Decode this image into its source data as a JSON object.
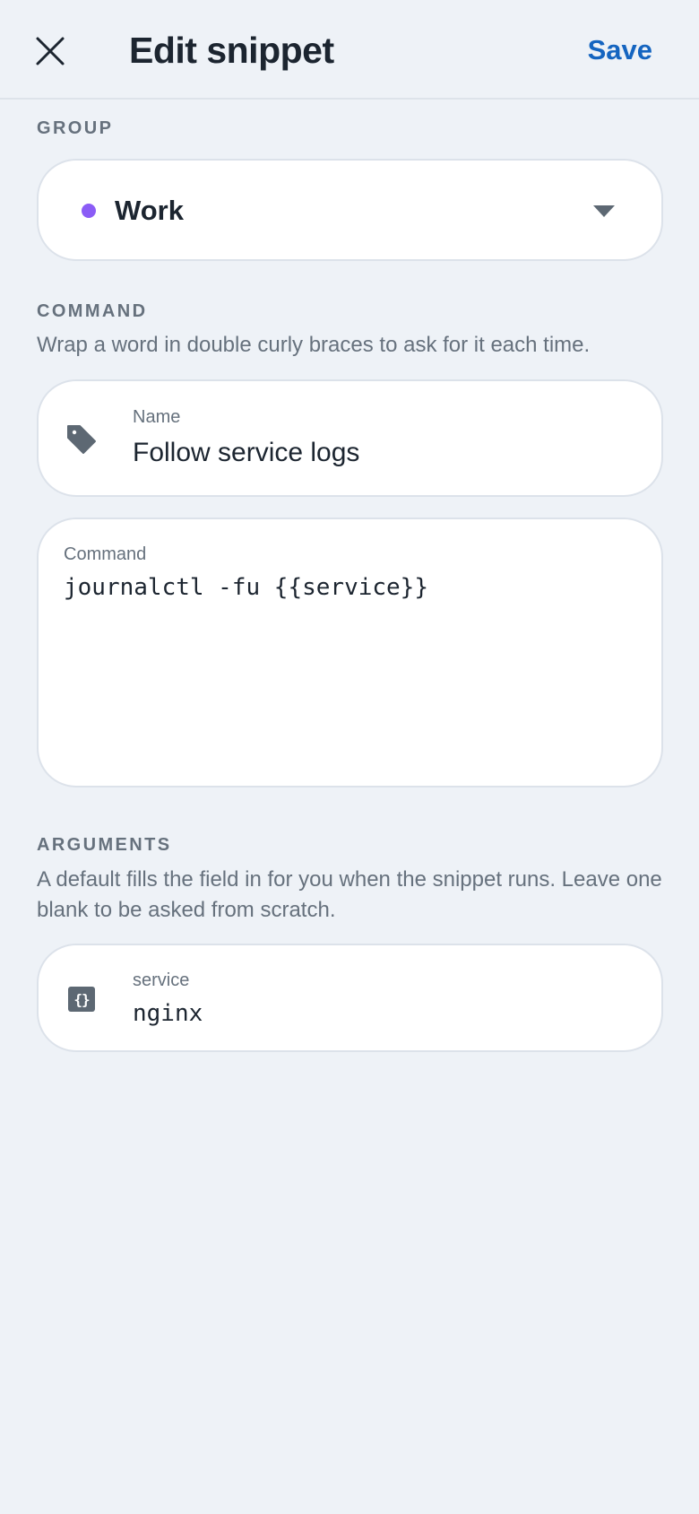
{
  "header": {
    "title": "Edit snippet",
    "save_label": "Save",
    "close_icon": "close-icon"
  },
  "group": {
    "section_label": "GROUP",
    "selected": "Work",
    "dot_color": "#8b5cf6",
    "dropdown_icon": "caret-down-icon"
  },
  "command_section": {
    "section_label": "COMMAND",
    "hint": "Wrap a word in double curly braces to ask for it each time.",
    "name_field": {
      "label": "Name",
      "value": "Follow service logs",
      "icon": "tag-icon"
    },
    "command_field": {
      "label": "Command",
      "value": "journalctl -fu {{service}}"
    }
  },
  "arguments": {
    "section_label": "ARGUMENTS",
    "hint": "A default fills the field in for you when the snippet runs. Leave one blank to be asked from scratch.",
    "items": [
      {
        "name": "service",
        "default": "nginx",
        "icon": "braces-icon"
      }
    ]
  },
  "colors": {
    "background": "#eef2f7",
    "accent": "#1565c0",
    "muted_text": "#66717d",
    "card_border": "#dce2ea"
  }
}
